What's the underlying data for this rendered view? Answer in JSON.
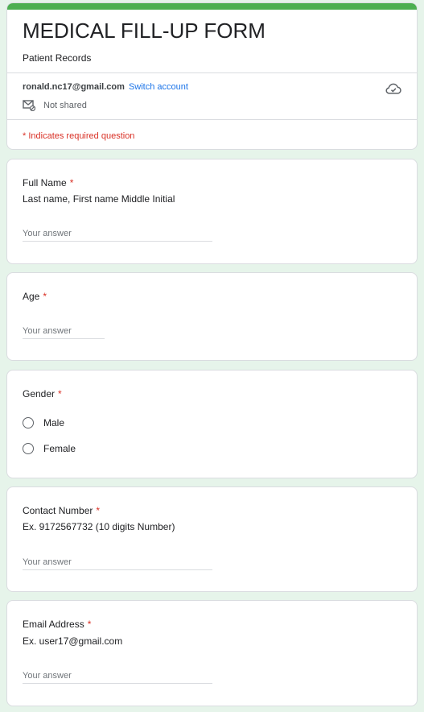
{
  "form": {
    "title": "MEDICAL FILL-UP FORM",
    "description": "Patient Records",
    "account_email": "ronald.nc17@gmail.com",
    "switch_account_label": "Switch account",
    "share_status": "Not shared",
    "required_note": "* Indicates required question",
    "accent_color": "#4caf50",
    "background_color": "#e6f4ea"
  },
  "questions": {
    "full_name": {
      "label": "Full Name",
      "required_mark": "*",
      "description": "Last name, First name Middle Initial",
      "placeholder": "Your answer"
    },
    "age": {
      "label": "Age",
      "required_mark": "*",
      "placeholder": "Your answer"
    },
    "gender": {
      "label": "Gender",
      "required_mark": "*",
      "options": [
        "Male",
        "Female"
      ]
    },
    "contact_number": {
      "label": "Contact Number",
      "required_mark": "*",
      "description": "Ex. 9172567732 (10 digits Number)",
      "placeholder": "Your answer"
    },
    "email": {
      "label": "Email Address",
      "required_mark": "*",
      "description": "Ex. user17@gmail.com",
      "placeholder": "Your answer"
    }
  }
}
